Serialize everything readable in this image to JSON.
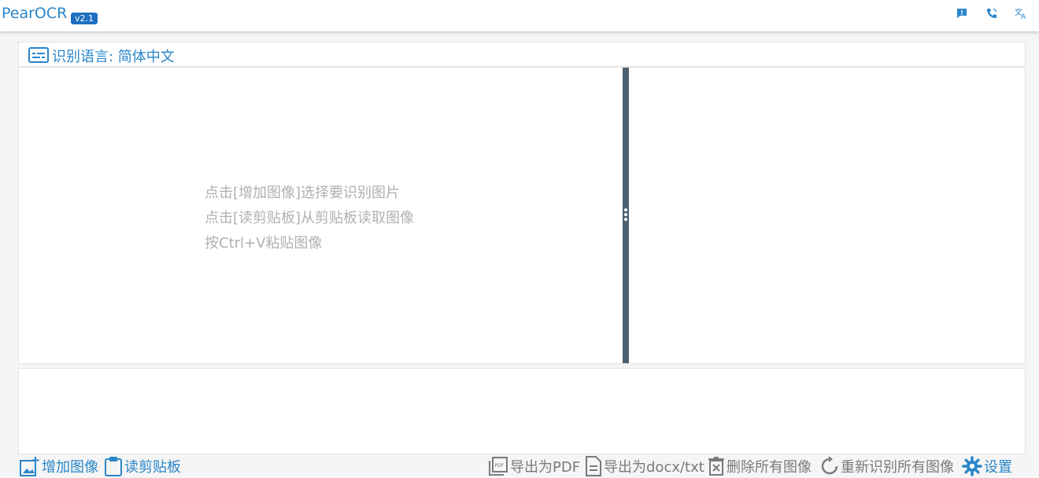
{
  "app": {
    "title": "PearOCR",
    "version": "v2.1"
  },
  "top_icons": [
    "feedback-icon",
    "contact-phone-icon",
    "translate-icon"
  ],
  "language": {
    "label": "识别语言: 简体中文"
  },
  "hints": [
    "点击[增加图像]选择要识别图片",
    "点击[读剪贴板]从剪贴板读取图像",
    "按Ctrl+V粘贴图像"
  ],
  "toolbar": {
    "add_image": "增加图像",
    "read_clipboard": "读剪贴板",
    "export_pdf": "导出为PDF",
    "export_docx": "导出为docx/txt",
    "delete_all": "删除所有图像",
    "rerecognize_all": "重新识别所有图像",
    "settings": "设置"
  },
  "colors": {
    "accent": "#2a86c9",
    "badge": "#1e6fbf",
    "splitter": "#4d6170",
    "hint": "#b0b0b0",
    "disabled": "#7a7a7a"
  }
}
